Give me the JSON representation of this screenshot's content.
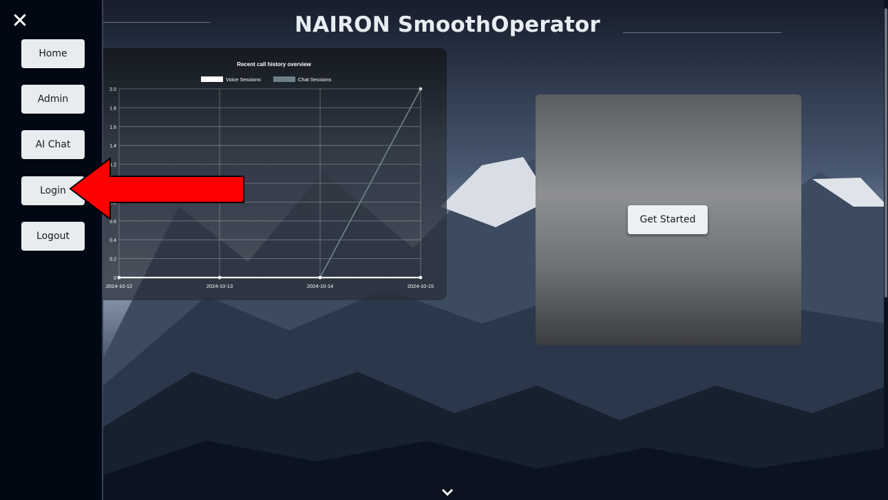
{
  "app": {
    "title": "NAIRON SmoothOperator"
  },
  "sidebar": {
    "close_icon": "close-icon",
    "items": [
      {
        "label": "Home"
      },
      {
        "label": "Admin"
      },
      {
        "label": "AI Chat"
      },
      {
        "label": "Login"
      },
      {
        "label": "Logout"
      }
    ]
  },
  "chart_data": {
    "type": "line",
    "title": "Recent call history overview",
    "xlabel": "",
    "ylabel": "",
    "categories": [
      "2024-10-12",
      "2024-10-13",
      "2024-10-14",
      "2024-10-15"
    ],
    "series": [
      {
        "name": "Voice Sessions",
        "values": [
          0,
          0,
          0,
          0
        ],
        "color": "#ffffff"
      },
      {
        "name": "Chat Sessions",
        "values": [
          0,
          0,
          0,
          2
        ],
        "color": "#6d8087"
      }
    ],
    "ylim": [
      0,
      2.0
    ],
    "yticks": [
      "0",
      "0.2",
      "0.4",
      "0.6",
      "0.8",
      "1.0",
      "1.2",
      "1.4",
      "1.6",
      "1.8",
      "2.0"
    ],
    "grid": true,
    "legend": "top-center"
  },
  "cta": {
    "label": "Get Started"
  },
  "scroll_hint_icon": "chevron-down-icon",
  "annotation": {
    "color": "#ff0000",
    "points_to": "Login"
  }
}
